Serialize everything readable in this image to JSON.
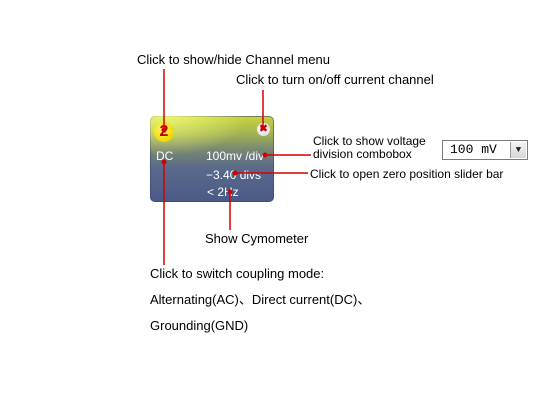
{
  "annotations": {
    "channel_menu": "Click to show/hide Channel menu",
    "turn_onoff": "Click to turn on/off current channel",
    "voltage_combo_line1": "Click to show voltage",
    "voltage_combo_line2": "division combobox",
    "zero_slider": "Click to open zero position slider bar",
    "cymometer": "Show Cymometer",
    "coupling_line1": "Click to switch coupling mode:",
    "coupling_line2": "Alternating(AC)、Direct current(DC)、",
    "coupling_line3": "Grounding(GND)"
  },
  "panel": {
    "channel_number": "2",
    "close_glyph": "✖",
    "coupling": "DC",
    "volts_per_div": "100mv /div",
    "zero_position": "−3.40 divs",
    "frequency": "< 2Hz"
  },
  "combobox": {
    "value": "100 mV",
    "arrow": "▼"
  },
  "colors": {
    "arrow_red": "#d40000",
    "panel_top": "#c9d23a",
    "panel_bottom": "#4a5a88"
  }
}
